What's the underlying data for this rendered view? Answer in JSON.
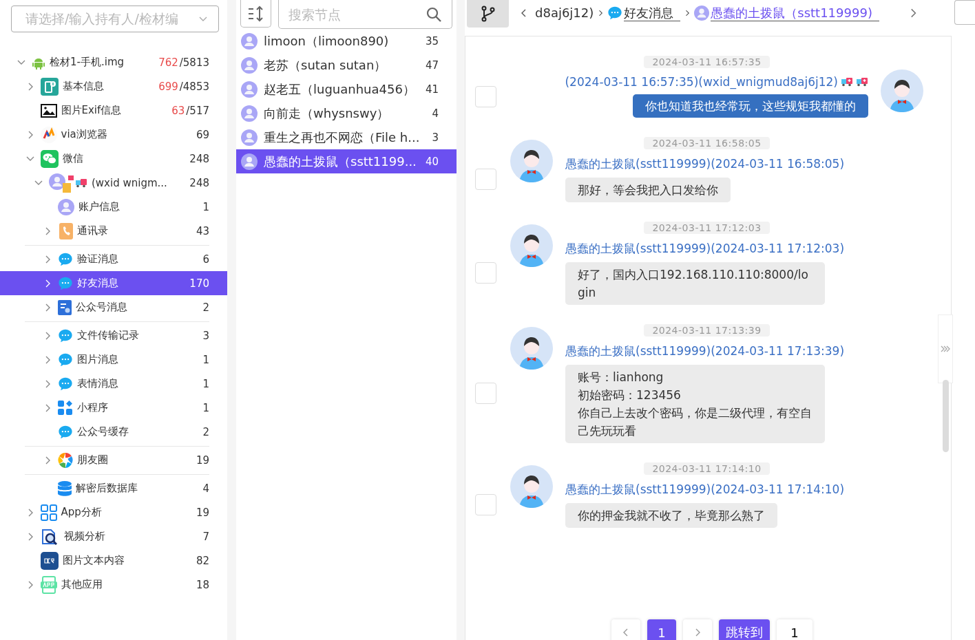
{
  "owner_select": {
    "placeholder": "请选择/输入持有人/检材编"
  },
  "tree": [
    {
      "label": "检材1-手机.img",
      "kind": "android",
      "flagged": "762",
      "count": "/5813",
      "expanded": true,
      "selected": false,
      "children": [
        {
          "label": "基本信息",
          "kind": "info",
          "flagged": "699",
          "count": "/4853",
          "expanded": false,
          "selected": false
        },
        {
          "label": "图片Exif信息",
          "kind": "image",
          "flagged": "63",
          "count": "/517",
          "selected": false
        },
        {
          "label": "via浏览器",
          "kind": "via",
          "count": "69",
          "expanded": false,
          "selected": false
        },
        {
          "label": "微信",
          "kind": "wechat",
          "count": "248",
          "expanded": true,
          "selected": false,
          "children": [
            {
              "label": "(wxid wnigm...",
              "kind": "account",
              "count": "248",
              "expanded": true,
              "selected": false,
              "children": [
                {
                  "label": "账户信息",
                  "kind": "person",
                  "count": "1",
                  "selected": false
                },
                {
                  "label": "通讯录",
                  "kind": "phonebook",
                  "count": "43",
                  "expanded": false,
                  "selected": false,
                  "divider_after": true
                },
                {
                  "label": "验证消息",
                  "kind": "chat",
                  "count": "6",
                  "expanded": false,
                  "selected": false
                },
                {
                  "label": "好友消息",
                  "kind": "chat",
                  "count": "170",
                  "expanded": false,
                  "selected": true
                },
                {
                  "label": "公众号消息",
                  "kind": "official",
                  "count": "2",
                  "expanded": false,
                  "selected": false,
                  "divider_after": true
                },
                {
                  "label": "文件传输记录",
                  "kind": "chat",
                  "count": "3",
                  "expanded": false,
                  "selected": false
                },
                {
                  "label": "图片消息",
                  "kind": "chat",
                  "count": "1",
                  "expanded": false,
                  "selected": false
                },
                {
                  "label": "表情消息",
                  "kind": "chat",
                  "count": "1",
                  "expanded": false,
                  "selected": false
                },
                {
                  "label": "小程序",
                  "kind": "mini",
                  "count": "1",
                  "expanded": false,
                  "selected": false
                },
                {
                  "label": "公众号缓存",
                  "kind": "chat",
                  "count": "2",
                  "selected": false,
                  "divider_after": true
                },
                {
                  "label": "朋友圈",
                  "kind": "moments",
                  "count": "19",
                  "expanded": false,
                  "selected": false,
                  "divider_after": true
                },
                {
                  "label": "解密后数据库",
                  "kind": "database",
                  "count": "4",
                  "selected": false
                }
              ]
            }
          ]
        },
        {
          "label": "App分析",
          "kind": "apps",
          "count": "19",
          "expanded": false,
          "selected": false
        },
        {
          "label": "视频分析",
          "kind": "video",
          "count": "7",
          "expanded": false,
          "selected": false
        },
        {
          "label": "图片文本内容",
          "kind": "ocr",
          "count": "82",
          "selected": false
        },
        {
          "label": "其他应用",
          "kind": "app",
          "count": "18",
          "expanded": false,
          "selected": false
        }
      ]
    }
  ],
  "node_search": {
    "placeholder": "搜索节点"
  },
  "contacts": [
    {
      "name": "limoon（limoon890)",
      "count": "35",
      "selected": false
    },
    {
      "name": "老苏（sutan sutan）",
      "count": "47",
      "selected": false
    },
    {
      "name": "赵老五（luguanhua456）",
      "count": "41",
      "selected": false
    },
    {
      "name": "向前走（whysnswy）",
      "count": "4",
      "selected": false
    },
    {
      "name": "重生之再也不网恋（File h...",
      "count": "3",
      "selected": false
    },
    {
      "name": "愚蠢的土拨鼠（sstt1199...",
      "count": "40",
      "selected": true
    }
  ],
  "breadcrumb": [
    {
      "label": "d8aj6j12)",
      "kind": "text"
    },
    {
      "label": "好友消息",
      "kind": "chat"
    },
    {
      "label": "愚蠢的土拨鼠（sstt119999)",
      "kind": "contact"
    }
  ],
  "messages": [
    {
      "time": "2024-03-11 16:57:35",
      "kind": "outgoing",
      "header": "(2024-03-11 16:57:35)(wxid_wnigmud8aj6j12)",
      "text": "你也知道我也经常玩，这些规矩我都懂的",
      "checked": false
    },
    {
      "time": "2024-03-11 16:58:05",
      "kind": "incoming",
      "header": "愚蠢的土拨鼠(sstt119999)(2024-03-11 16:58:05)",
      "text": "那好，等会我把入口发给你",
      "checked": false
    },
    {
      "time": "2024-03-11 17:12:03",
      "kind": "incoming",
      "header": "愚蠢的土拨鼠(sstt119999)(2024-03-11 17:12:03)",
      "text": "好了，国内入口192.168.110.110:8000/login",
      "checked": false
    },
    {
      "time": "2024-03-11 17:13:39",
      "kind": "incoming",
      "header": "愚蠢的土拨鼠(sstt119999)(2024-03-11 17:13:39)",
      "text": "账号：lianhong\n初始密码：123456\n你自己上去改个密码，你是二级代理，有空自己先玩玩看",
      "checked": false
    },
    {
      "time": "2024-03-11 17:14:10",
      "kind": "incoming",
      "header": "愚蠢的土拨鼠(sstt119999)(2024-03-11 17:14:10)",
      "text": "你的押金我就不收了，毕竟那么熟了",
      "checked": false
    }
  ],
  "pagination": {
    "pages": [
      {
        "label": "1",
        "selected": true
      }
    ],
    "jump_label": "跳转到",
    "jump_value": "1"
  }
}
